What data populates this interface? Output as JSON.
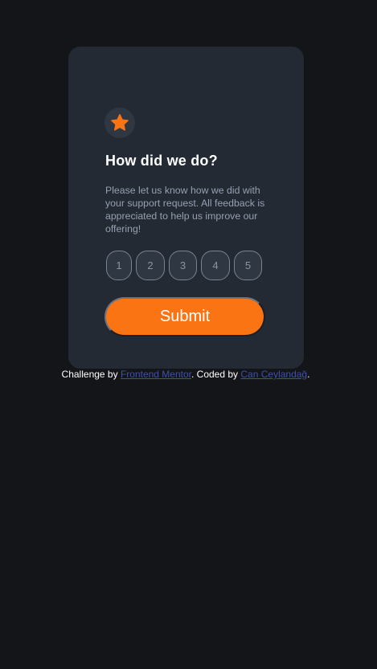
{
  "card": {
    "icon": "star-icon",
    "title": "How did we do?",
    "description": "Please let us know how we did with your support request. All feedback is appreciated to help us improve our offering!",
    "ratings": [
      "1",
      "2",
      "3",
      "4",
      "5"
    ],
    "submit_label": "Submit"
  },
  "attribution": {
    "prefix": "Challenge by ",
    "link1": "Frontend Mentor",
    "middle": ". Coded by ",
    "link2": "Can Ceylandağ",
    "suffix": "."
  },
  "colors": {
    "background": "#141519",
    "card": "#232a34",
    "accent": "#fb7413",
    "muted_text": "#96a0b2",
    "link": "#3e52a3"
  }
}
